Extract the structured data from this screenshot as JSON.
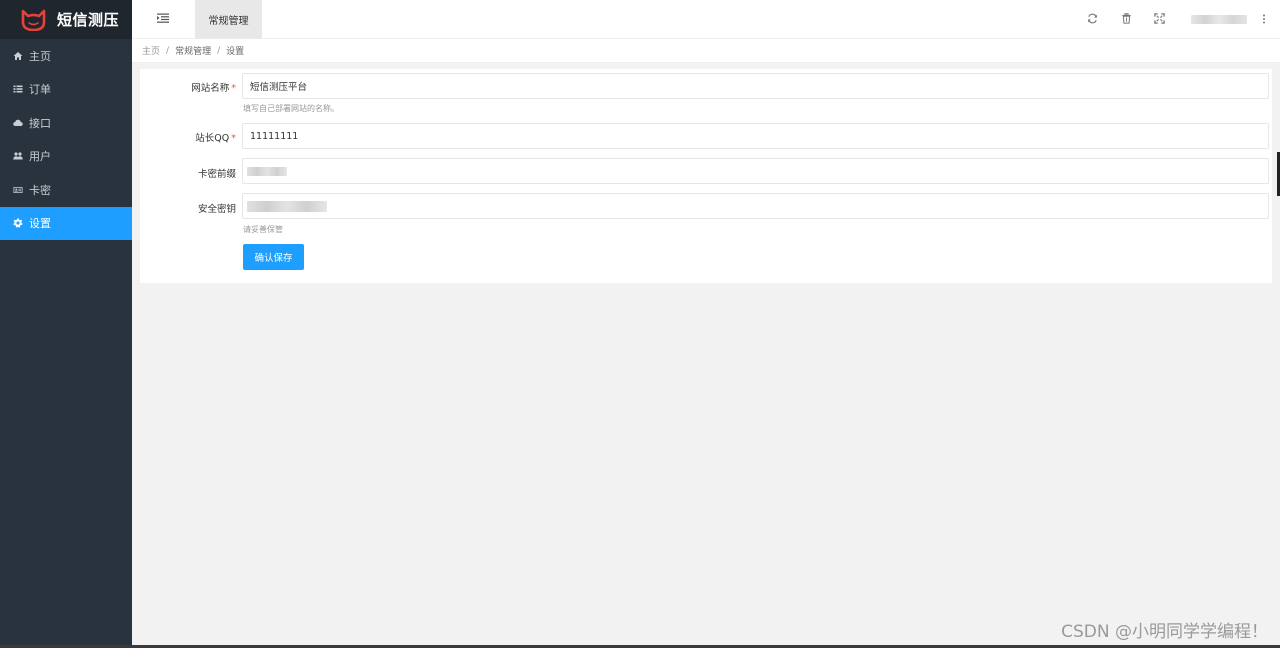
{
  "app": {
    "logo_text": "短信测压",
    "accent_color": "#1e9fff",
    "logo_color": "#e8403a"
  },
  "sidebar": {
    "items": [
      {
        "label": "主页",
        "icon": "home-icon",
        "active": false
      },
      {
        "label": "订单",
        "icon": "list-icon",
        "active": false
      },
      {
        "label": "接口",
        "icon": "cloud-icon",
        "active": false
      },
      {
        "label": "用户",
        "icon": "users-icon",
        "active": false
      },
      {
        "label": "卡密",
        "icon": "id-card-icon",
        "active": false
      },
      {
        "label": "设置",
        "icon": "gear-icon",
        "active": true
      }
    ]
  },
  "header": {
    "active_tab": "常规管理",
    "icons": [
      "refresh-icon",
      "trash-icon",
      "fullscreen-icon",
      "more-icon"
    ]
  },
  "breadcrumb": {
    "items": [
      "主页",
      "常规管理",
      "设置"
    ],
    "separator": "/"
  },
  "form": {
    "site_name": {
      "label": "网站名称",
      "required": "*",
      "value": "短信测压平台",
      "hint": "填写自己部署网站的名称。"
    },
    "admin_qq": {
      "label": "站长QQ",
      "required": "*",
      "value": "11111111"
    },
    "card_prefix": {
      "label": "卡密前缀"
    },
    "secret_key": {
      "label": "安全密钥",
      "hint": "请妥善保管"
    },
    "save_label": "确认保存"
  },
  "watermark": "CSDN @小明同学学编程！"
}
